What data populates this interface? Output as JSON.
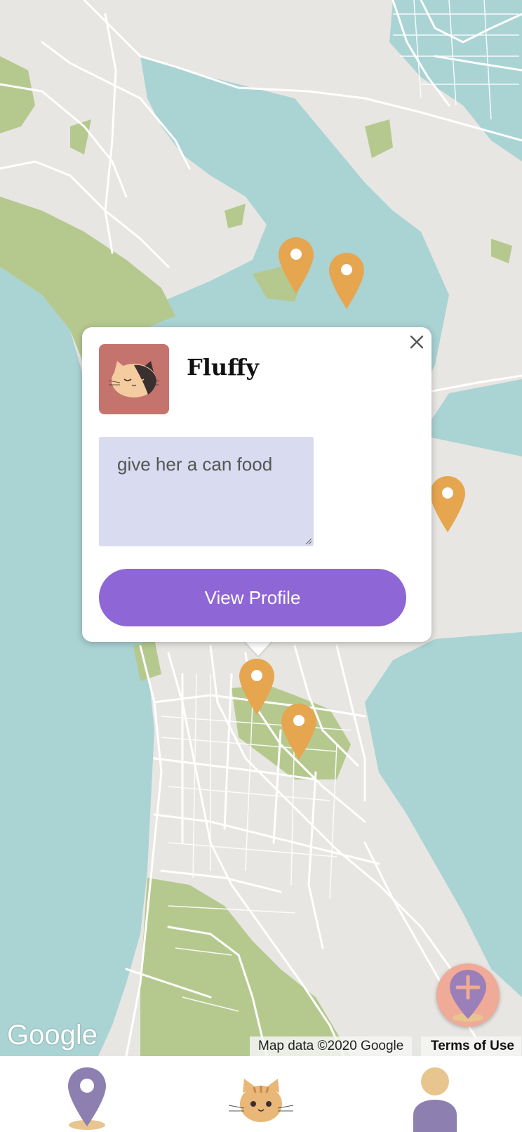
{
  "map": {
    "pins": [
      {
        "id": "pin-1"
      },
      {
        "id": "pin-2"
      },
      {
        "id": "pin-3"
      },
      {
        "id": "pin-4"
      },
      {
        "id": "pin-5"
      }
    ],
    "google_logo": "Google",
    "attribution": "Map data ©2020 Google",
    "terms_label": "Terms of Use",
    "add_button_icon": "add-location-icon"
  },
  "popup": {
    "cat_name": "Fluffy",
    "note": "give her a can food",
    "view_profile_label": "View Profile",
    "close_icon": "close-icon",
    "avatar_icon": "cat-face-icon"
  },
  "bottom_nav": {
    "items": [
      {
        "icon": "map-pin-icon"
      },
      {
        "icon": "cat-icon"
      },
      {
        "icon": "profile-icon"
      }
    ]
  },
  "colors": {
    "water": "#aad3d4",
    "land": "#e8e6e2",
    "park": "#b5c98f",
    "pin": "#e6a54f",
    "accent": "#8e66d6",
    "note_bg": "#d9dbf0",
    "fab": "#f0aa98"
  }
}
